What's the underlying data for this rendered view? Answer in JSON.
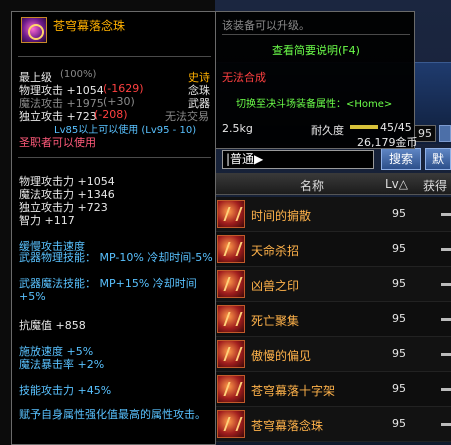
{
  "background": {
    "level_box": "95",
    "search_value": "|普通▶",
    "search_button": "搜索",
    "search_button2": "默",
    "columns": {
      "name": "名称",
      "lv": "Lv△",
      "obtain": "获得"
    },
    "rows": [
      {
        "name": "时间的掮散",
        "lv": "95"
      },
      {
        "name": "天命杀招",
        "lv": "95"
      },
      {
        "name": "凶兽之印",
        "lv": "95"
      },
      {
        "name": "死亡聚集",
        "lv": "95"
      },
      {
        "name": "傲慢的偏见",
        "lv": "95"
      },
      {
        "name": "苍穹幕落十字架",
        "lv": "95"
      },
      {
        "name": "苍穹幕落念珠",
        "lv": "95"
      }
    ]
  },
  "tooltip": {
    "item_name": "苍穹幕落念珠",
    "grade": "最上级",
    "grade_pct": "(100%)",
    "rarity": "史诗",
    "type": "念珠",
    "category": "武器",
    "trade": "无法交易",
    "phys_atk": "物理攻击 +1054",
    "phys_atk_diff": "(-1629)",
    "mag_atk": "魔法攻击 +1975",
    "mag_atk_diff": "(+30)",
    "ind_atk": "独立攻击 +723",
    "ind_atk_diff": "(-208)",
    "level_req": "Lv85以上可以使用 (Lv95 - 10)",
    "class_req": "圣职者可以使用",
    "stats": [
      "物理攻击力 +1054",
      "魔法攻击力 +1346",
      "独立攻击力 +723",
      "智力 +117"
    ],
    "slow_speed": "缓慢攻击速度",
    "phys_skill": "武器物理技能：  MP-10% 冷却时间-5%",
    "mag_skill": "武器魔法技能：  MP+15% 冷却时间+5%",
    "anti_magic": "抗魔值 +858",
    "cast_speed": "施放速度 +5%",
    "mag_crit": "魔法暴击率 +2%",
    "skill_atk": "技能攻击力 +45%",
    "elem_desc": "赋予自身属性强化值最高的属性攻击。"
  },
  "side": {
    "upgrade": "该装备可以升级。",
    "view_link": "查看简要说明(F4)",
    "no_synth": "无法合成",
    "switch": "切换至决斗场装备属性：<Home>",
    "weight": "2.5kg",
    "durability_label": "耐久度",
    "durability": "45/45",
    "price": "26,179金币"
  },
  "colors": {
    "gold": "#ffb000",
    "red": "#ff4040",
    "green": "#6cff4a",
    "pink": "#ff5a7a"
  }
}
